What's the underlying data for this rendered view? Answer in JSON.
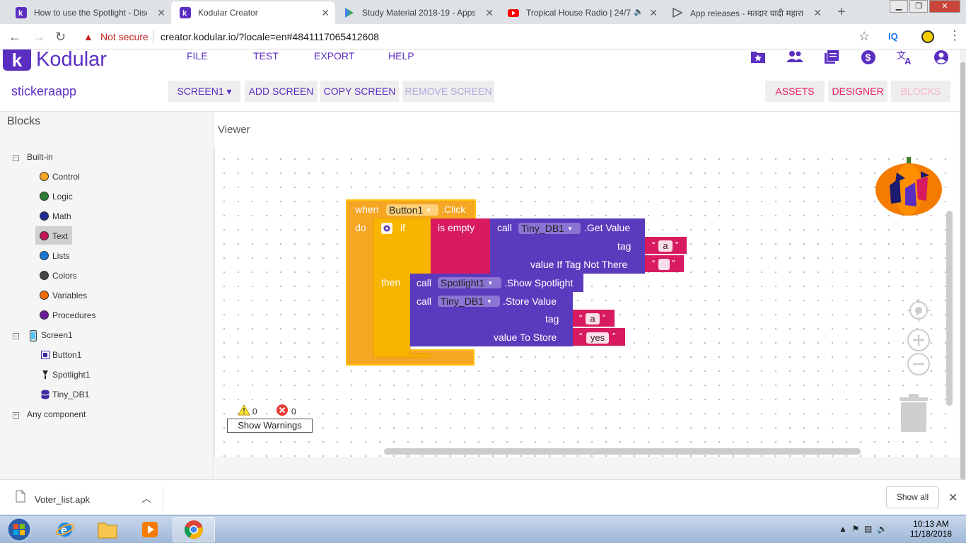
{
  "browser": {
    "tabs": [
      {
        "title": "How to use the Spotlight - Disc"
      },
      {
        "title": "Kodular Creator"
      },
      {
        "title": "Study Material 2018-19 - Apps"
      },
      {
        "title": "Tropical House Radio | 24/7"
      },
      {
        "title": "App releases - मतदार यादी महाराष"
      }
    ],
    "new_tab": "+",
    "security": "Not secure",
    "url": "creator.kodular.io/?locale=en#4841117065412608",
    "ext_label": "IQ"
  },
  "app": {
    "logo_letter": "k",
    "logo_text": "Kodular",
    "menu": [
      "FILE",
      "TEST",
      "EXPORT",
      "HELP"
    ],
    "project_name": "stickeraapp",
    "screen_select": "SCREEN1 ▾",
    "add_screen": "ADD SCREEN",
    "copy_screen": "COPY SCREEN",
    "remove_screen": "REMOVE SCREEN",
    "assets": "ASSETS",
    "designer": "DESIGNER",
    "blocks": "BLOCKS"
  },
  "left_panel": {
    "title": "Blocks",
    "builtin": "Built-in",
    "categories": [
      {
        "label": "Control",
        "color": "#f5a623"
      },
      {
        "label": "Logic",
        "color": "#2e7d32"
      },
      {
        "label": "Math",
        "color": "#1e2f8f"
      },
      {
        "label": "Text",
        "color": "#c2185b"
      },
      {
        "label": "Lists",
        "color": "#1976d2"
      },
      {
        "label": "Colors",
        "color": "#444444"
      },
      {
        "label": "Variables",
        "color": "#ef6c00"
      },
      {
        "label": "Procedures",
        "color": "#6a1b9a"
      }
    ],
    "screen": "Screen1",
    "components": [
      "Button1",
      "Spotlight1",
      "Tiny_DB1"
    ],
    "any_component": "Any component"
  },
  "viewer": {
    "title": "Viewer",
    "blocks": {
      "when": "when",
      "button": "Button1",
      "click": ".Click",
      "do": "do",
      "if": "if",
      "is_empty": "is empty",
      "then": "then",
      "call1": "call",
      "tinydb1": "Tiny_DB1",
      "get_value": ".Get Value",
      "tag1": "tag",
      "str_a1": "a",
      "value_if": "value If Tag Not There",
      "call2": "call",
      "spotlight": "Spotlight1",
      "show_spotlight": ".Show Spotlight",
      "call3": "call",
      "tinydb2": "Tiny_DB1",
      "store_value": ".Store Value",
      "tag2": "tag",
      "str_a2": "a",
      "value_to_store": "value To Store",
      "str_yes": "yes"
    },
    "warnings_count": "0",
    "errors_count": "0",
    "show_warnings": "Show Warnings"
  },
  "downloads": {
    "file": "Voter_list.apk",
    "show_all": "Show all"
  },
  "taskbar": {
    "time": "10:13 AM",
    "date": "11/18/2018"
  }
}
